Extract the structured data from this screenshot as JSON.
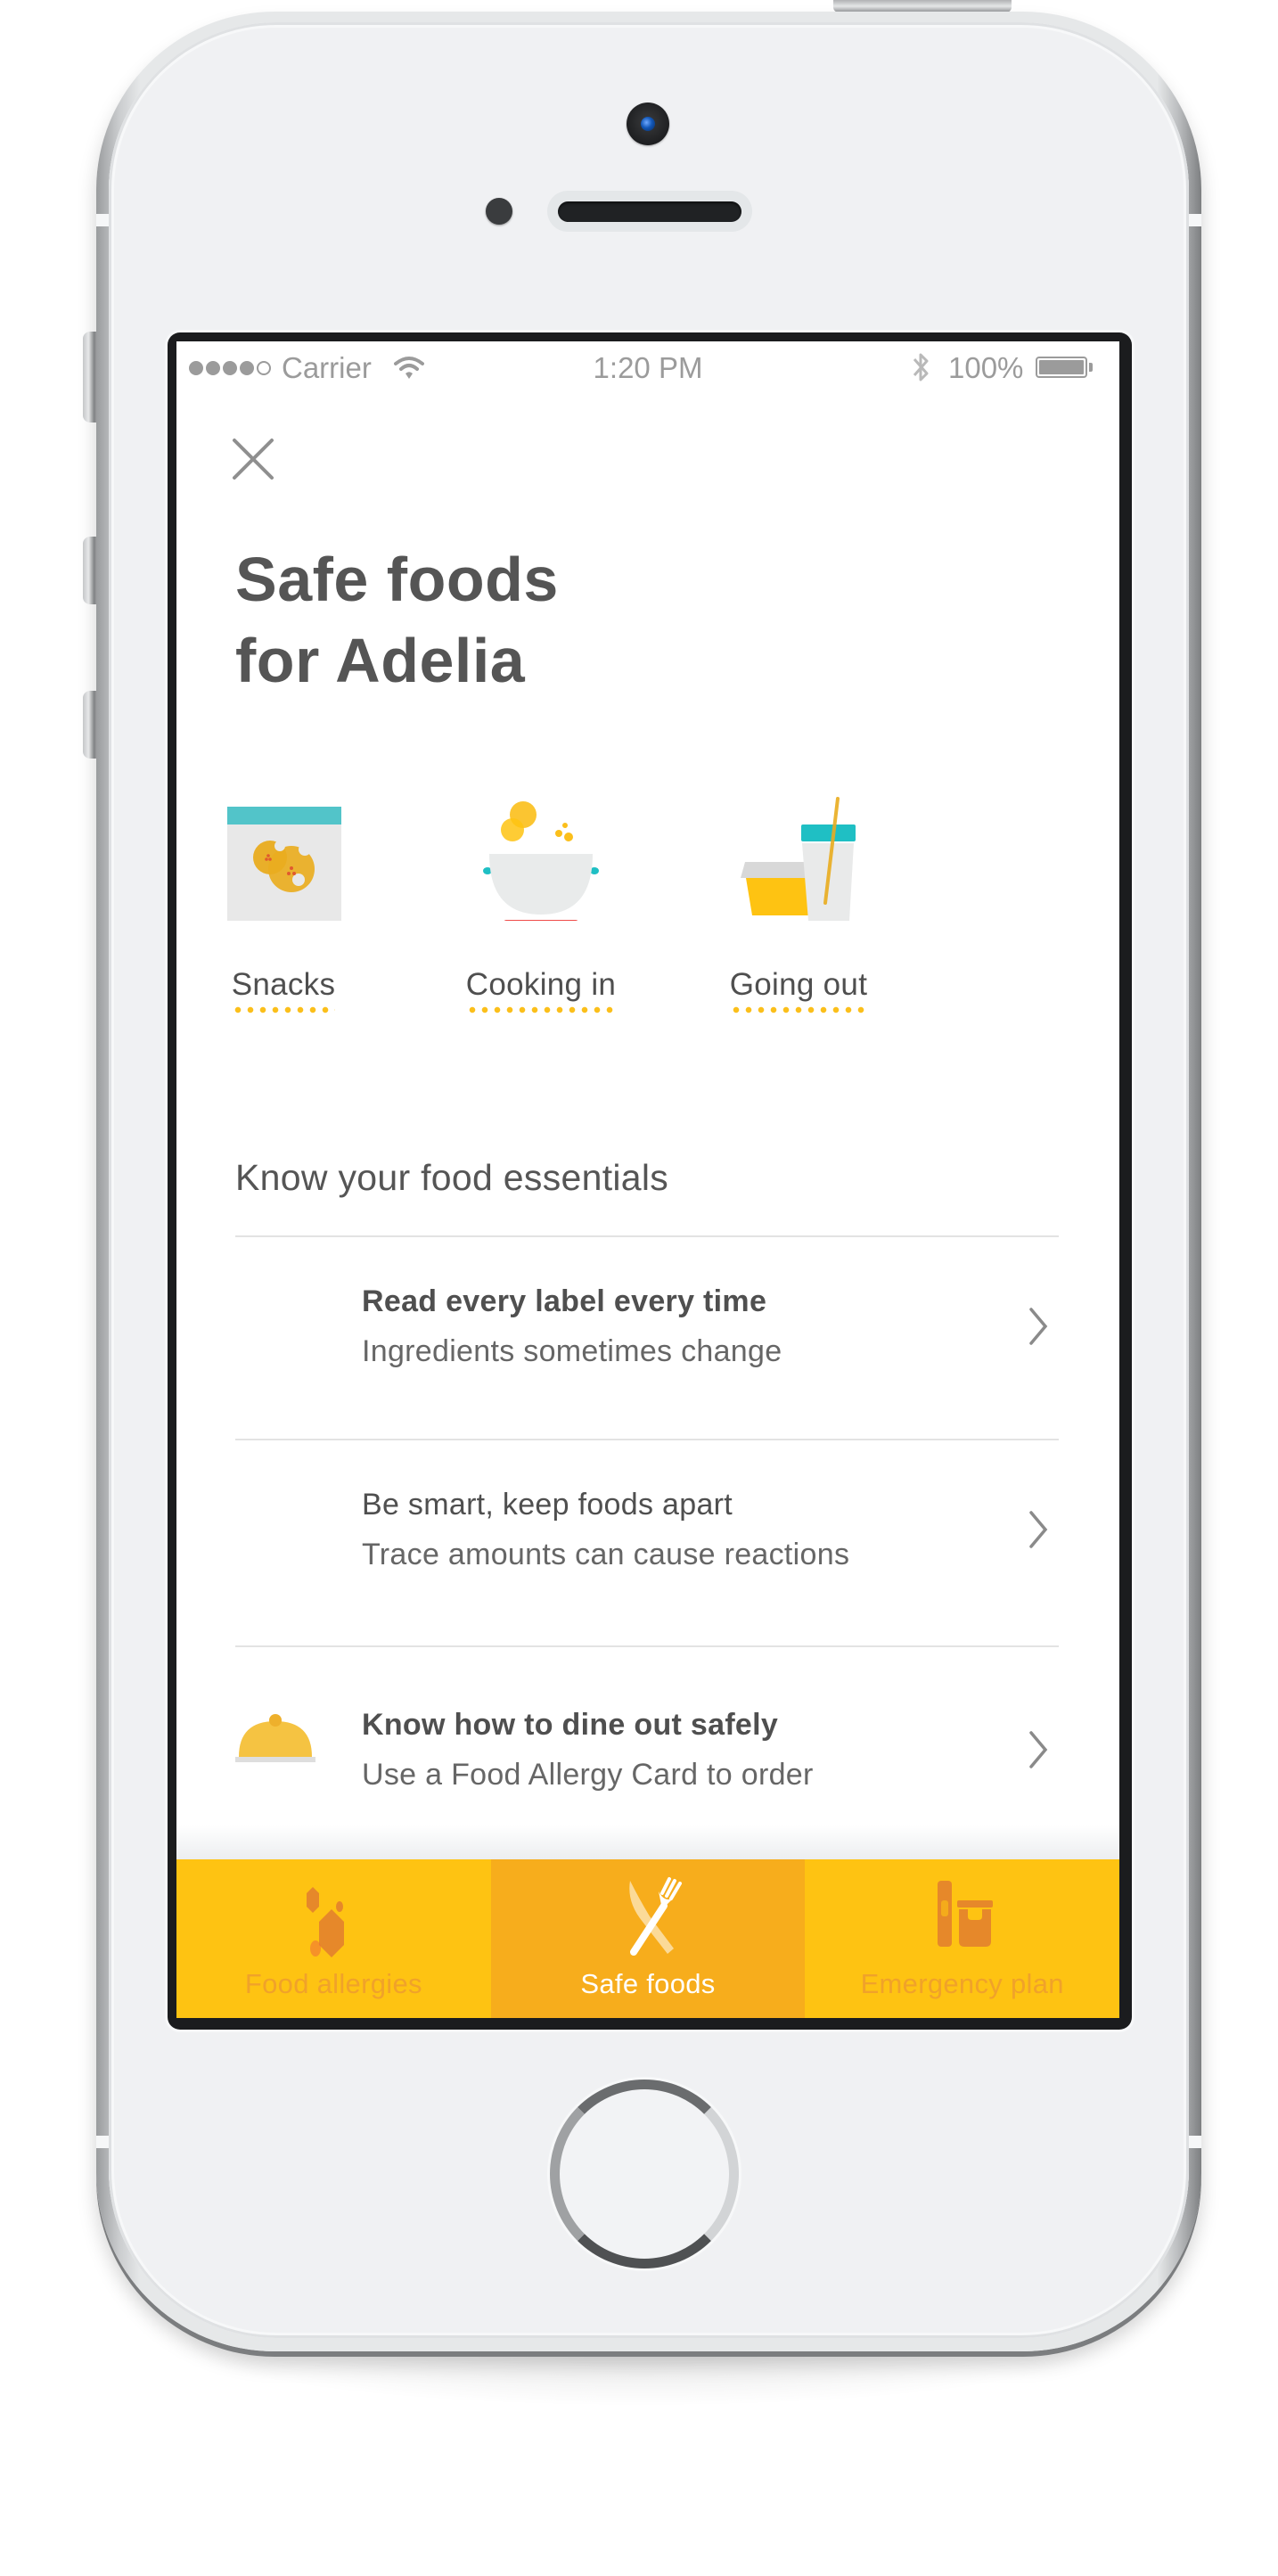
{
  "status_bar": {
    "signal_bars_filled": 4,
    "signal_bars_total": 5,
    "carrier": "Carrier",
    "wifi_icon": "wifi-icon",
    "time": "1:20 PM",
    "bluetooth_icon": "bluetooth-icon",
    "battery_percent": "100%",
    "battery_level": 1.0
  },
  "header": {
    "close_icon": "close-icon",
    "title": "Safe foods\nfor Adelia"
  },
  "categories": [
    {
      "label": "Snacks",
      "icon": "snacks-bag-icon"
    },
    {
      "label": "Cooking in",
      "icon": "cooking-pot-icon"
    },
    {
      "label": "Going out",
      "icon": "takeout-food-drink-icon"
    }
  ],
  "essentials": {
    "title": "Know your food essentials",
    "items": [
      {
        "title": "Read every label every time",
        "subtitle": "Ingredients sometimes change",
        "icon": null
      },
      {
        "title": "Be smart, keep foods apart",
        "subtitle": "Trace amounts can cause reactions",
        "icon": null
      },
      {
        "title": "Know how to dine out safely",
        "subtitle": "Use a Food Allergy Card to order",
        "icon": "serving-cloche-icon"
      }
    ]
  },
  "tabbar": {
    "tabs": [
      {
        "label": "Food allergies",
        "icon": "allergen-hexagons-icon",
        "active": false
      },
      {
        "label": "Safe foods",
        "icon": "knife-fork-icon",
        "active": true
      },
      {
        "label": "Emergency plan",
        "icon": "epipen-jar-icon",
        "active": false
      }
    ]
  },
  "colors": {
    "accent_yellow": "#fec312",
    "active_tab": "#f7ad1c",
    "inactive_tab_text": "#f0a22a",
    "icon_orange": "#e6882a",
    "teal": "#4fc4c8",
    "red": "#ef4b49",
    "text_dark": "#555555"
  }
}
